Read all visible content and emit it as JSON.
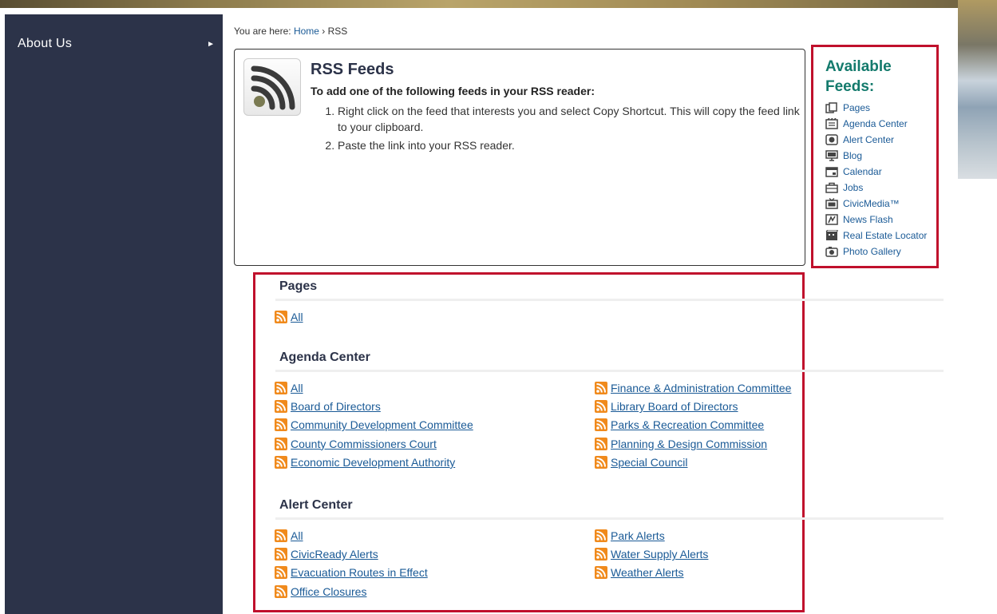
{
  "sidebar": {
    "items": [
      {
        "label": "About Us",
        "arrow": "►"
      }
    ]
  },
  "breadcrumb": {
    "prefix": "You are here: ",
    "home": "Home",
    "sep": " › ",
    "current": "RSS"
  },
  "rss_box": {
    "title": "RSS Feeds",
    "intro": "To add one of the following feeds in your RSS reader:",
    "steps": [
      "Right click on the feed that interests you and select Copy Shortcut. This will copy the feed link to your clipboard.",
      "Paste the link into your RSS reader."
    ]
  },
  "available_feeds": {
    "title_line1": "Available",
    "title_line2": "Feeds:",
    "items": [
      {
        "label": "Pages",
        "icon": "pages-icon"
      },
      {
        "label": "Agenda Center",
        "icon": "agenda-center-icon"
      },
      {
        "label": "Alert Center",
        "icon": "alert-center-icon"
      },
      {
        "label": "Blog",
        "icon": "blog-icon"
      },
      {
        "label": "Calendar",
        "icon": "calendar-icon"
      },
      {
        "label": "Jobs",
        "icon": "jobs-icon"
      },
      {
        "label": "CivicMedia™",
        "icon": "civicmedia-icon"
      },
      {
        "label": "News Flash",
        "icon": "news-flash-icon"
      },
      {
        "label": "Real Estate Locator",
        "icon": "real-estate-locator-icon"
      },
      {
        "label": "Photo Gallery",
        "icon": "photo-gallery-icon"
      }
    ]
  },
  "sections": {
    "pages": {
      "title": "Pages",
      "col1": [
        "All"
      ],
      "col2": []
    },
    "agenda": {
      "title": "Agenda Center",
      "col1": [
        "All",
        "Board of Directors",
        "Community Development Committee",
        "County Commissioners Court",
        "Economic Development Authority"
      ],
      "col2": [
        "Finance & Administration Committee",
        "Library Board of Directors",
        "Parks & Recreation Committee",
        "Planning & Design Commission",
        "Special Council"
      ]
    },
    "alert": {
      "title": "Alert Center",
      "col1": [
        "All",
        "CivicReady Alerts",
        "Evacuation Routes in Effect",
        "Office Closures"
      ],
      "col2": [
        "Park Alerts",
        "Water Supply Alerts",
        "Weather Alerts"
      ]
    }
  },
  "colors": {
    "sidebar": "#2c3349",
    "link": "#1a5a96",
    "highlight_border": "#c0102c",
    "available_title": "#137a6c",
    "rss_orange": "#f08a1c"
  }
}
